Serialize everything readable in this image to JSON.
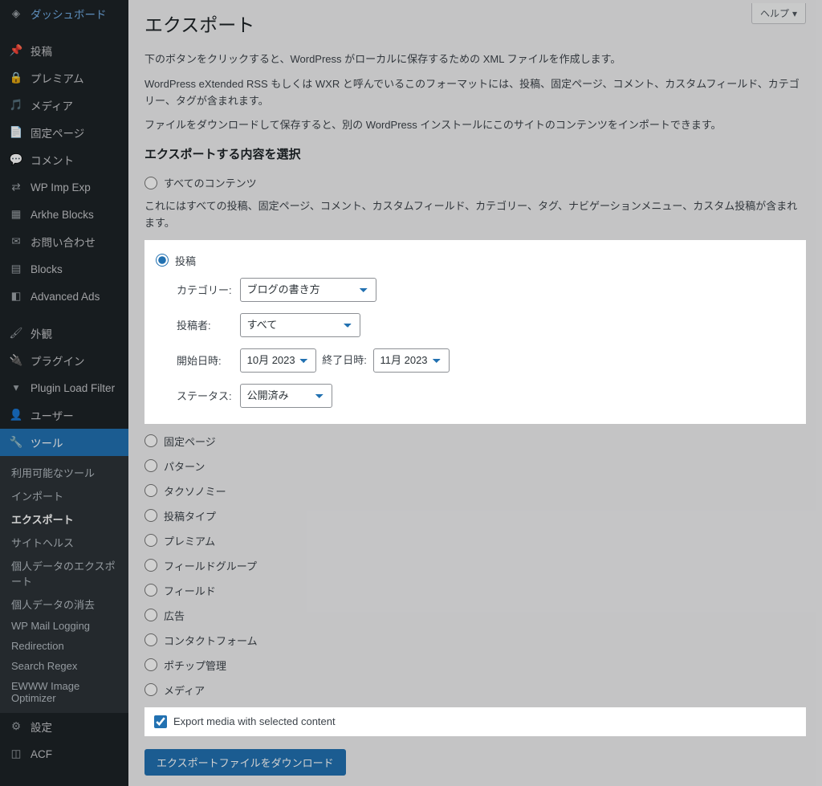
{
  "help_label": "ヘルプ",
  "page_title": "エクスポート",
  "desc1": "下のボタンをクリックすると、WordPress がローカルに保存するための XML ファイルを作成します。",
  "desc2": "WordPress eXtended RSS もしくは WXR と呼んでいるこのフォーマットには、投稿、固定ページ、コメント、カスタムフィールド、カテゴリー、タグが含まれます。",
  "desc3": "ファイルをダウンロードして保存すると、別の WordPress インストールにこのサイトのコンテンツをインポートできます。",
  "section_heading": "エクスポートする内容を選択",
  "all_content_label": "すべてのコンテンツ",
  "all_content_desc": "これにはすべての投稿、固定ページ、コメント、カスタムフィールド、カテゴリー、タグ、ナビゲーションメニュー、カスタム投稿が含まれます。",
  "posts_label": "投稿",
  "filters": {
    "category_label": "カテゴリー:",
    "category_value": "ブログの書き方",
    "author_label": "投稿者:",
    "author_value": "すべて",
    "start_label": "開始日時:",
    "start_value": "10月 2023",
    "end_label": "終了日時:",
    "end_value": "11月 2023",
    "status_label": "ステータス:",
    "status_value": "公開済み"
  },
  "radios": {
    "pages": "固定ページ",
    "patterns": "パターン",
    "taxonomy": "タクソノミー",
    "post_type": "投稿タイプ",
    "premium": "プレミアム",
    "field_group": "フィールドグループ",
    "field": "フィールド",
    "ads": "広告",
    "contact": "コンタクトフォーム",
    "pochip": "ポチップ管理",
    "media": "メディア"
  },
  "export_media_label": "Export media with selected content",
  "download_button": "エクスポートファイルをダウンロード",
  "sidebar": {
    "dashboard": "ダッシュボード",
    "posts": "投稿",
    "premium": "プレミアム",
    "media": "メディア",
    "pages": "固定ページ",
    "comments": "コメント",
    "wpimpexp": "WP Imp Exp",
    "arkhe": "Arkhe Blocks",
    "contact": "お問い合わせ",
    "blocks": "Blocks",
    "adads": "Advanced Ads",
    "appearance": "外観",
    "plugins": "プラグイン",
    "plf": "Plugin Load Filter",
    "users": "ユーザー",
    "tools": "ツール",
    "settings": "設定",
    "acf": "ACF"
  },
  "submenu": {
    "available": "利用可能なツール",
    "import": "インポート",
    "export": "エクスポート",
    "sitehealth": "サイトヘルス",
    "personal_export": "個人データのエクスポート",
    "personal_erase": "個人データの消去",
    "wpmail": "WP Mail Logging",
    "redirection": "Redirection",
    "searchregex": "Search Regex",
    "ewww": "EWWW Image Optimizer"
  }
}
